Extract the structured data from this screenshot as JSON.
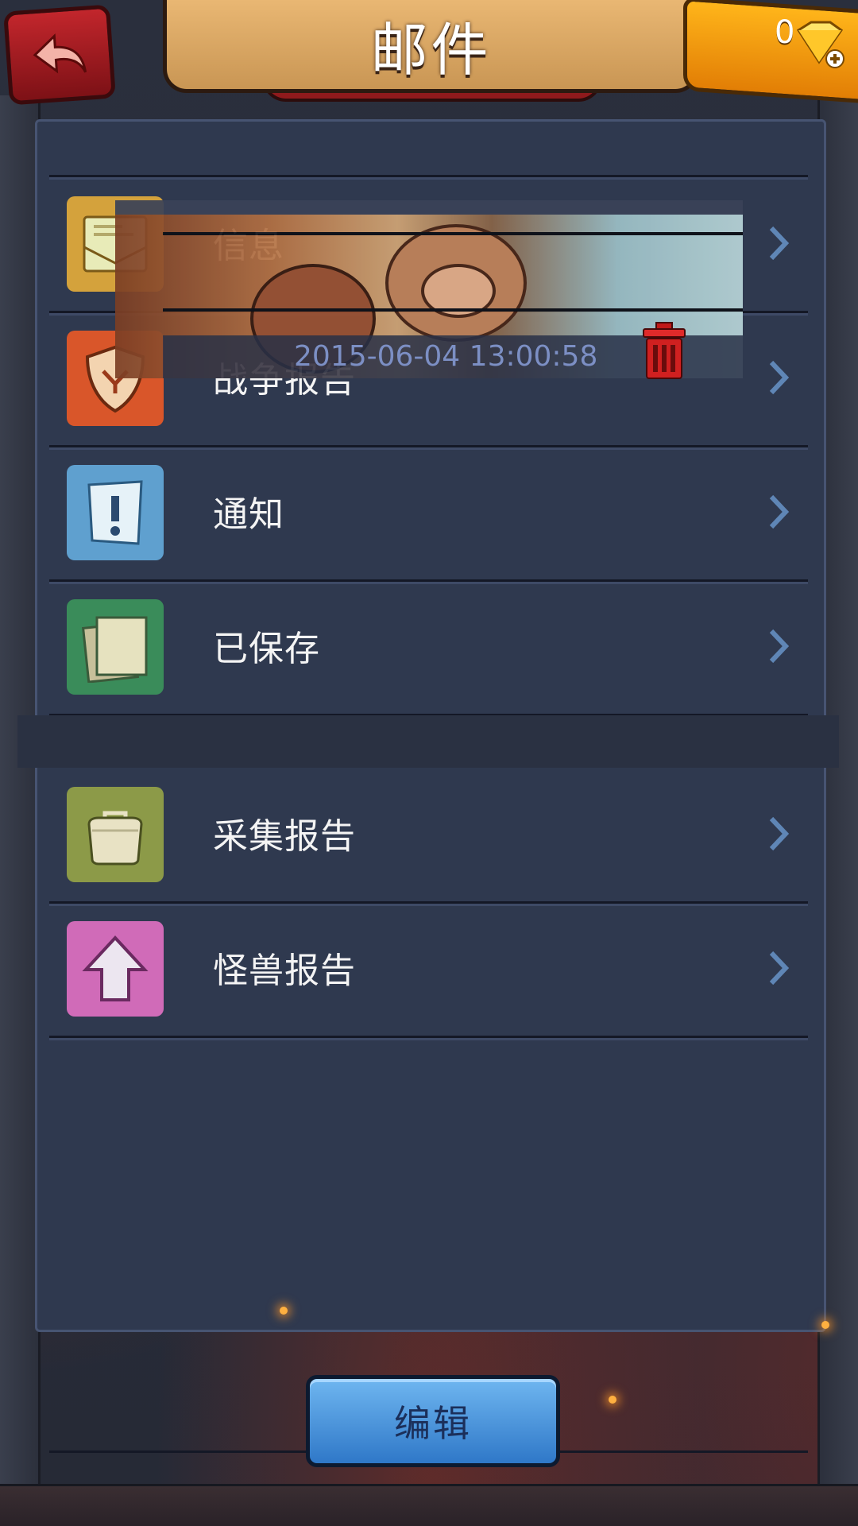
{
  "header": {
    "title": "邮件",
    "gem_count": "0"
  },
  "mail_overlay": {
    "date": "2015-06-04 13:00:58"
  },
  "menu": {
    "items": [
      {
        "label": "信息",
        "icon": "envelope-icon",
        "color": "#d4a23c"
      },
      {
        "label": "战争报告",
        "icon": "shield-icon",
        "color": "#d9562a"
      },
      {
        "label": "通知",
        "icon": "notice-icon",
        "color": "#5fa0cf"
      },
      {
        "label": "已保存",
        "icon": "saved-papers-icon",
        "color": "#3a8c5a"
      },
      {
        "label": "采集报告",
        "icon": "bag-icon",
        "color": "#8c9a48"
      },
      {
        "label": "怪兽报告",
        "icon": "arrow-up-icon",
        "color": "#d06bb8"
      }
    ]
  },
  "footer": {
    "edit_label": "编辑"
  }
}
